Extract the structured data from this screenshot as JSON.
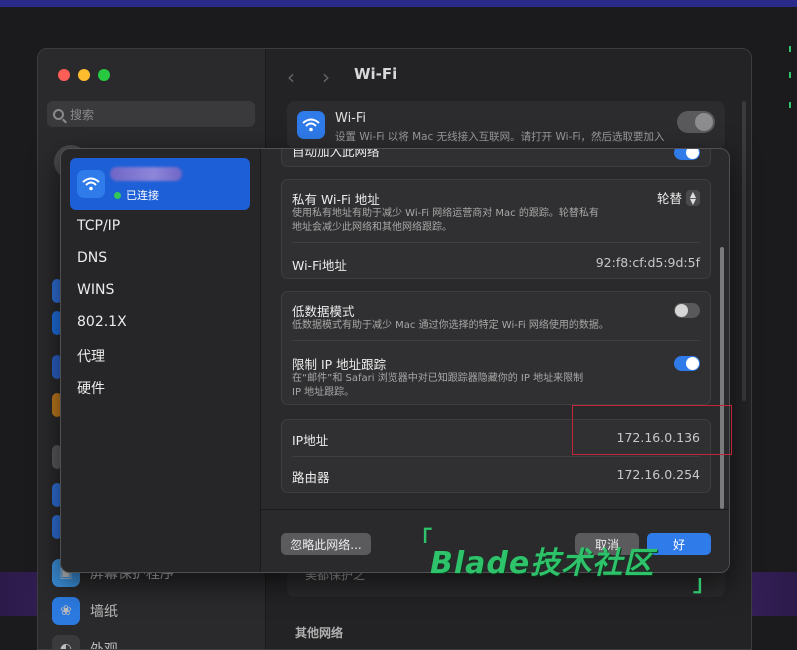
{
  "colors": {
    "accent": "#2f7bea",
    "selection": "#1d5fd6",
    "connected_dot": "#33c659",
    "highlight_box": "#c0283a",
    "watermark": "#2ec26a"
  },
  "settings_window": {
    "title": "Wi-Fi",
    "search_placeholder": "搜索",
    "wifi_card": {
      "title": "Wi-Fi",
      "description": "设置 Wi-Fi 以将 Mac 无线接入互联网。请打开 Wi-Fi，然后选取要加入",
      "toggle_on": false
    },
    "bottom_field_label": "美都保护之",
    "other_networks_heading": "其他网络",
    "sidebar_peek": [
      {
        "label": "屏幕保护程序",
        "icon": "screensaver-icon"
      },
      {
        "label": "墙纸",
        "icon": "wallpaper-icon"
      },
      {
        "label": "外观",
        "icon": "appearance-icon"
      }
    ]
  },
  "dialog": {
    "network": {
      "status": "已连接",
      "icon": "wifi-icon"
    },
    "nav": [
      "TCP/IP",
      "DNS",
      "WINS",
      "802.1X",
      "代理",
      "硬件"
    ],
    "cut_row_title": "自动加入此网络",
    "private_address": {
      "title": "私有 Wi-Fi 地址",
      "desc_line1": "使用私有地址有助于减少 Wi-Fi 网络运营商对 Mac 的跟踪。轮替私有",
      "desc_line2": "地址会减少此网络和其他网络跟踪。",
      "value": "轮替"
    },
    "wifi_address": {
      "label": "Wi-Fi地址",
      "value": "92:f8:cf:d5:9d:5f"
    },
    "low_data": {
      "title": "低数据模式",
      "desc": "低数据模式有助于减少 Mac 通过你选择的特定 Wi-Fi 网络使用的数据。",
      "enabled": false
    },
    "limit_ip_tracking": {
      "title": "限制 IP 地址跟踪",
      "desc_line1": "在“邮件”和 Safari 浏览器中对已知跟踪器隐藏你的 IP 地址来限制",
      "desc_line2": "IP 地址跟踪。",
      "enabled": true
    },
    "ip": {
      "label": "IP地址",
      "value": "172.16.0.136"
    },
    "router": {
      "label": "路由器",
      "value": "172.16.0.254"
    },
    "buttons": {
      "forget": "忽略此网络...",
      "cancel": "取消",
      "ok": "好"
    }
  },
  "watermark": {
    "text": "Blade技术社区",
    "bracket_open": "「",
    "bracket_close": "」"
  }
}
